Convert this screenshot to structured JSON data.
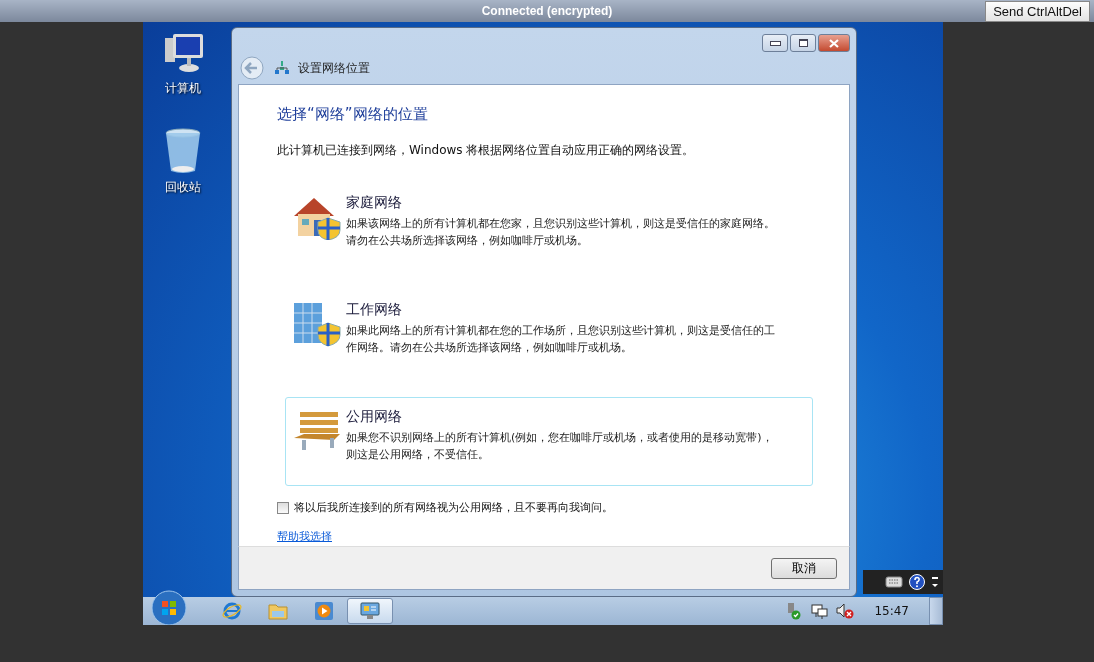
{
  "top_bar": {
    "status": "Connected (encrypted)",
    "button": "Send CtrlAltDel"
  },
  "desktop_icons": [
    {
      "label": "计算机"
    },
    {
      "label": "回收站"
    }
  ],
  "window": {
    "title": "设置网络位置",
    "heading": "选择“网络”网络的位置",
    "intro": "此计算机已连接到网络，Windows 将根据网络位置自动应用正确的网络设置。",
    "options": [
      {
        "title": "家庭网络",
        "description": "如果该网络上的所有计算机都在您家，且您识别这些计算机，则这是受信任的家庭网络。请勿在公共场所选择该网络，例如咖啡厅或机场。",
        "selected": false
      },
      {
        "title": "工作网络",
        "description": "如果此网络上的所有计算机都在您的工作场所，且您识别这些计算机，则这是受信任的工作网络。请勿在公共场所选择该网络，例如咖啡厅或机场。",
        "selected": false
      },
      {
        "title": "公用网络",
        "description": "如果您不识别网络上的所有计算机(例如，您在咖啡厅或机场，或者使用的是移动宽带)，则这是公用网络，不受信任。",
        "selected": true
      }
    ],
    "checkbox": {
      "label": "将以后我所连接到的所有网络视为公用网络，且不要再向我询问。",
      "checked": false
    },
    "help_link": "帮助我选择",
    "cancel_button": "取消"
  },
  "taskbar": {
    "apps": [
      {
        "selected": false
      },
      {
        "selected": false
      },
      {
        "selected": false
      },
      {
        "selected": true
      }
    ],
    "clock": "15:47"
  }
}
